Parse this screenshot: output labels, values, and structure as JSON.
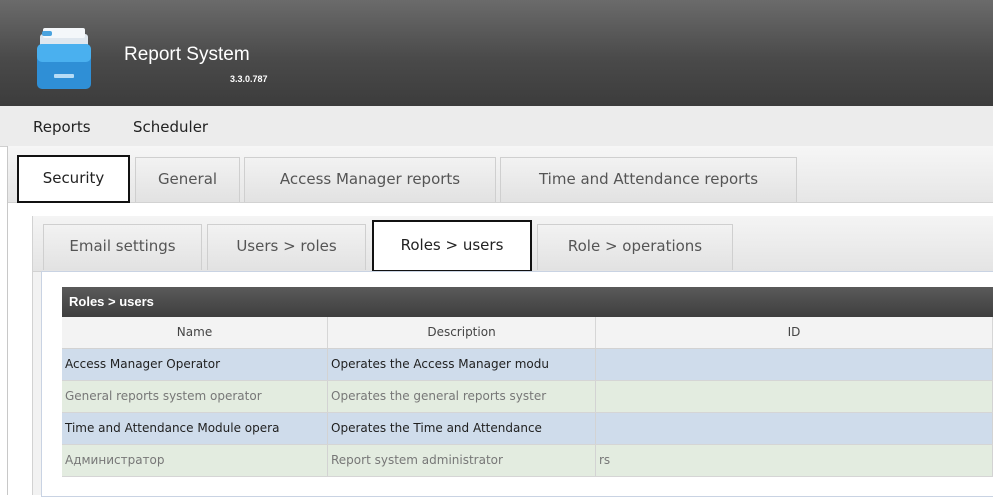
{
  "app": {
    "title": "Report System",
    "version": "3.3.0.787",
    "logo_icon": "folder-icon"
  },
  "menu": {
    "items": [
      {
        "label": "Reports"
      },
      {
        "label": "Scheduler"
      }
    ]
  },
  "outer_tabs": [
    {
      "label": "Security",
      "active": true
    },
    {
      "label": "General",
      "active": false
    },
    {
      "label": "Access Manager reports",
      "active": false
    },
    {
      "label": "Time and Attendance reports",
      "active": false
    }
  ],
  "inner_tabs": [
    {
      "label": "Email settings",
      "active": false
    },
    {
      "label": "Users > roles",
      "active": false
    },
    {
      "label": "Roles > users",
      "active": true
    },
    {
      "label": "Role > operations",
      "active": false
    }
  ],
  "grid": {
    "title": "Roles > users",
    "columns": [
      "Name",
      "Description",
      "ID"
    ],
    "rows": [
      {
        "name": "Access Manager Operator",
        "description": "Operates the Access Manager modu",
        "id": "",
        "color": "#cfdceb",
        "text_color": "#1f1f1f"
      },
      {
        "name": "General reports system operator",
        "description": "Operates the general reports syster",
        "id": "",
        "color": "#e3ece0",
        "text_color": "#777777"
      },
      {
        "name": "Time and Attendance Module opera",
        "description": "Operates the Time and Attendance",
        "id": "",
        "color": "#cfdceb",
        "text_color": "#1f1f1f"
      },
      {
        "name": "Администратор",
        "description": "Report system administrator",
        "id": "rs",
        "color": "#e3ece0",
        "text_color": "#777777"
      }
    ]
  },
  "colors": {
    "header_bg": "#4a4a4a",
    "selected_row": "#cfdceb",
    "alt_row": "#e3ece0",
    "active_tab_border": "#111111"
  }
}
